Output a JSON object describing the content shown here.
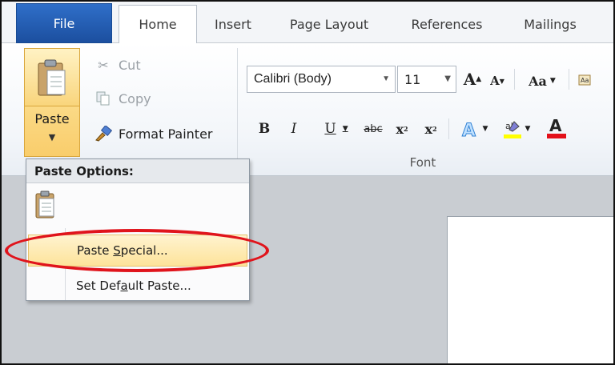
{
  "tabs": {
    "file": "File",
    "home": "Home",
    "insert": "Insert",
    "page_layout": "Page Layout",
    "references": "References",
    "mailings": "Mailings"
  },
  "clipboard": {
    "paste_label": "Paste",
    "cut_label": "Cut",
    "copy_label": "Copy",
    "format_painter_label": "Format Painter"
  },
  "font": {
    "name": "Calibri (Body)",
    "size": "11",
    "group_label": "Font",
    "bold": "B",
    "italic": "I",
    "underline": "U",
    "strike": "abc",
    "subscript": "x",
    "superscript": "x",
    "grow": "A",
    "shrink": "A",
    "change_case": "Aa"
  },
  "paste_menu": {
    "header": "Paste Options:",
    "paste_special_pre": "Paste ",
    "paste_special_ul": "S",
    "paste_special_post": "pecial...",
    "set_default_pre": "Set Def",
    "set_default_ul": "a",
    "set_default_post": "ult Paste..."
  },
  "colors": {
    "file_tab": "#2f6fc9",
    "highlight_ring": "#e0141c",
    "menu_hover": "#fde39a",
    "font_color_bar": "#e3101a",
    "highlight_bar": "#ffff00"
  }
}
